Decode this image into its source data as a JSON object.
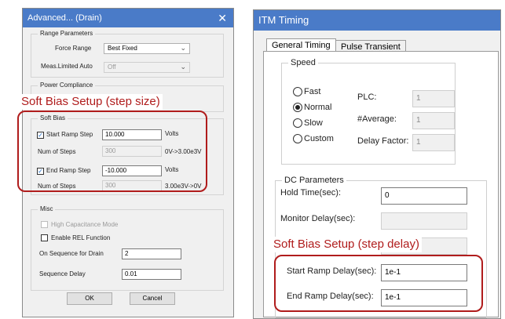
{
  "left_dialog": {
    "title": "Advanced... (Drain)",
    "close_glyph": "✕",
    "range": {
      "group_title": "Range Parameters",
      "force_range_label": "Force Range",
      "force_range_value": "Best Fixed",
      "meas_label": "Meas.Limited Auto",
      "meas_value": "Off"
    },
    "power": {
      "group_title": "Power Compliance"
    },
    "soft_bias": {
      "group_title": "Soft Bias",
      "start_label": "Start Ramp Step",
      "start_value": "10.000",
      "start_unit": "Volts",
      "start_steps_label": "Num of Steps",
      "start_steps_value": "300",
      "start_range": "0V->3.00e3V",
      "end_label": "End Ramp Step",
      "end_value": "-10.000",
      "end_unit": "Volts",
      "end_steps_label": "Num of Steps",
      "end_steps_value": "300",
      "end_range": "3.00e3V->0V"
    },
    "misc": {
      "group_title": "Misc",
      "high_cap_label": "High Capacitance Mode",
      "rel_label": "Enable REL Function",
      "on_seq_label": "On Sequence for Drain",
      "on_seq_value": "2",
      "seq_delay_label": "Sequence Delay",
      "seq_delay_value": "0.01"
    },
    "ok_label": "OK",
    "cancel_label": "Cancel"
  },
  "annotations": {
    "step_size": "Soft Bias Setup (step size)",
    "step_delay": "Soft Bias Setup (step delay)"
  },
  "right_dialog": {
    "title": "ITM Timing",
    "tabs": [
      "General Timing",
      "Pulse Transient"
    ],
    "speed": {
      "group_title": "Speed",
      "options": [
        "Fast",
        "Normal",
        "Slow",
        "Custom"
      ],
      "selected": "Normal",
      "plc_label": "PLC:",
      "plc_value": "1",
      "avg_label": "#Average:",
      "avg_value": "1",
      "delay_factor_label": "Delay Factor:",
      "delay_factor_value": "1"
    },
    "dc": {
      "group_title": "DC Parameters",
      "hold_label": "Hold Time(sec):",
      "hold_value": "0",
      "monitor_label": "Monitor Delay(sec):",
      "start_ramp_label": "Start Ramp Delay(sec):",
      "start_ramp_value": "1e-1",
      "end_ramp_label": "End Ramp Delay(sec):",
      "end_ramp_value": "1e-1"
    }
  }
}
